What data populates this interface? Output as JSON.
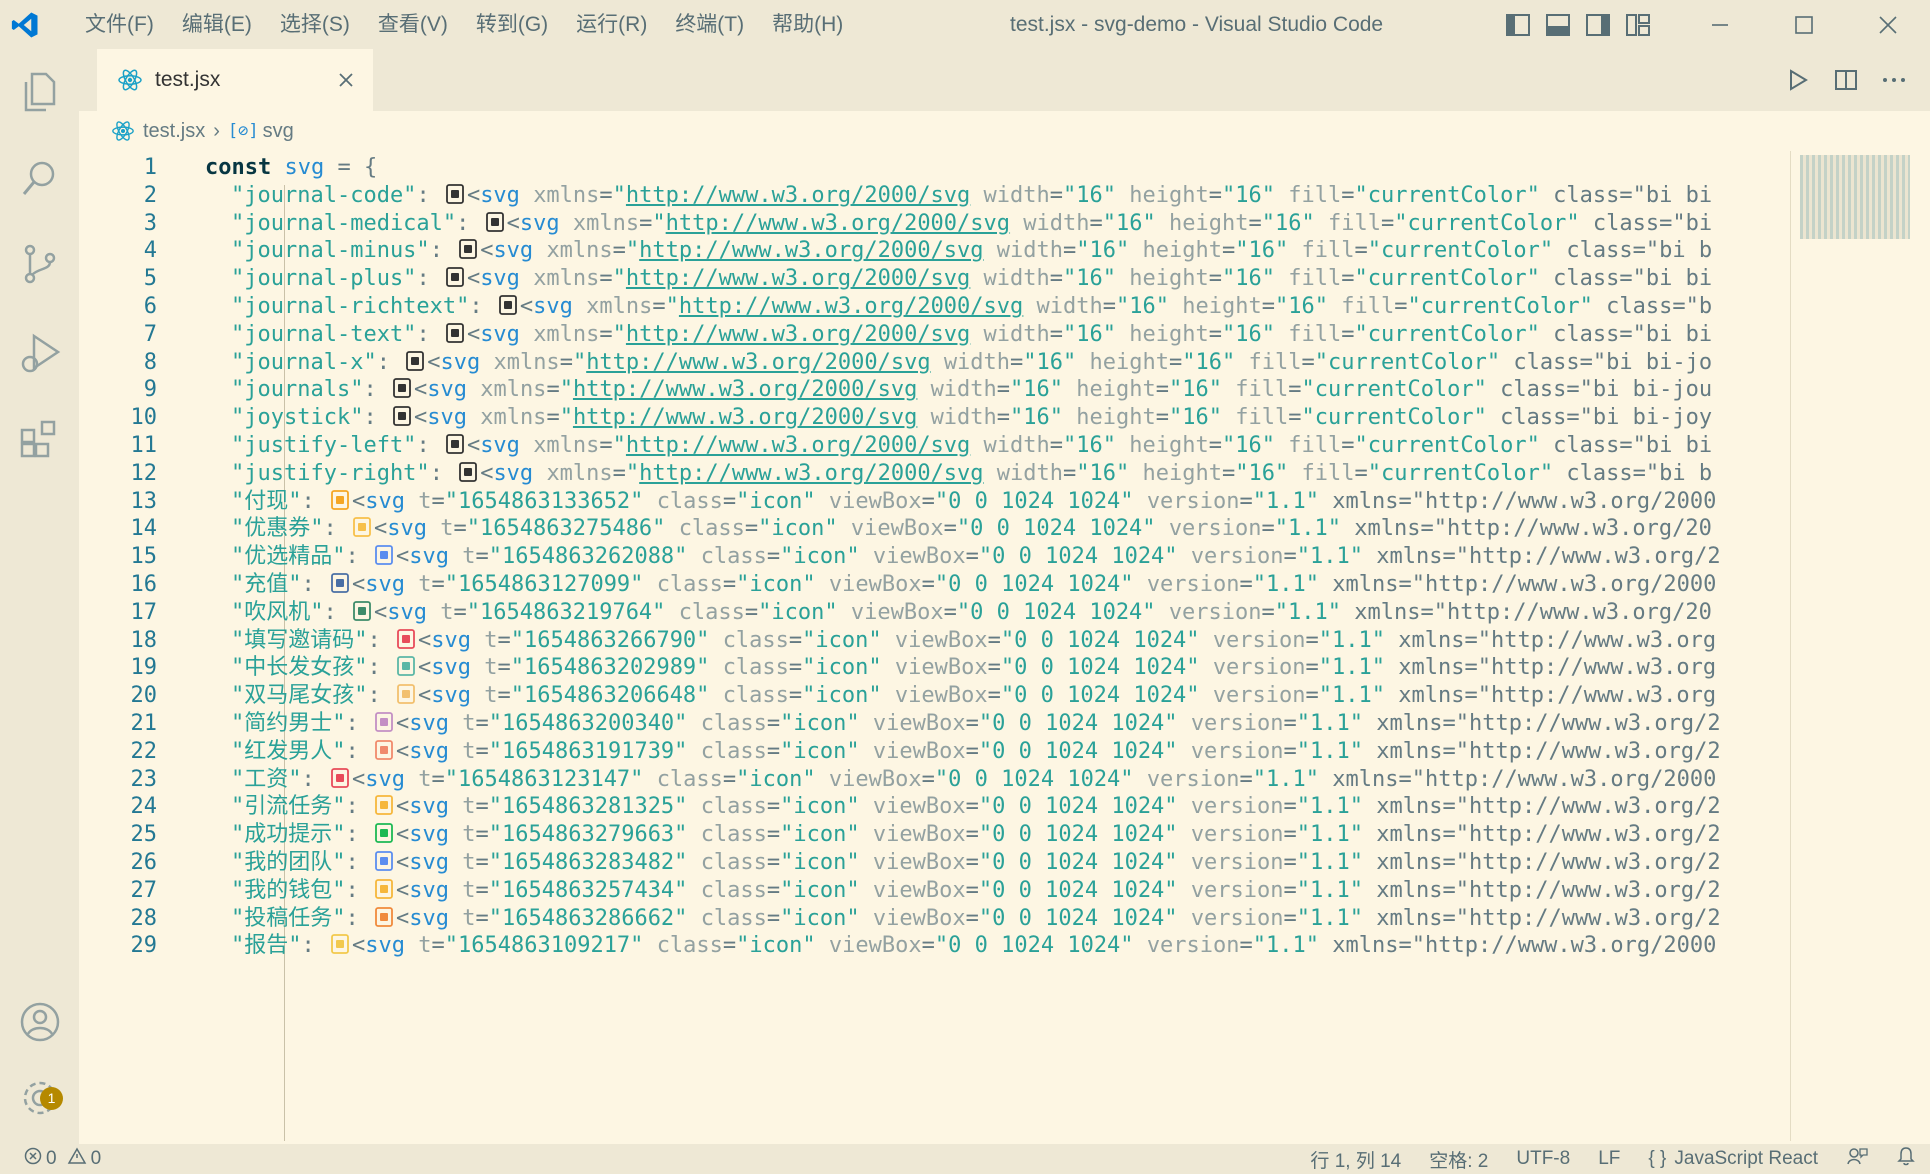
{
  "window": {
    "title": "test.jsx - svg-demo - Visual Studio Code",
    "menu": [
      "文件(F)",
      "编辑(E)",
      "选择(S)",
      "查看(V)",
      "转到(G)",
      "运行(R)",
      "终端(T)",
      "帮助(H)"
    ]
  },
  "tab": {
    "label": "test.jsx"
  },
  "breadcrumb": {
    "file": "test.jsx",
    "symbol": "svg"
  },
  "status": {
    "errors": "0",
    "warnings": "0",
    "position": "行 1, 列 14",
    "indent": "空格: 2",
    "encoding": "UTF-8",
    "eol": "LF",
    "language": "JavaScript React"
  },
  "badge": {
    "count": "1"
  },
  "colors": {
    "accent": "#b58900",
    "bg": "#fdf6e3",
    "chrome": "#eee8d5"
  },
  "code_lines": [
    {
      "n": "1",
      "key": "",
      "text": "const svg = {",
      "kind": "head"
    },
    {
      "n": "2",
      "key": "\"journal-code\"",
      "rest": "<svg xmlns=\"http://www.w3.org/2000/svg\" width=\"16\" height=\"16\" fill=\"currentColor\" class=\"bi bi"
    },
    {
      "n": "3",
      "key": "\"journal-medical\"",
      "rest": "<svg xmlns=\"http://www.w3.org/2000/svg\" width=\"16\" height=\"16\" fill=\"currentColor\" class=\"bi"
    },
    {
      "n": "4",
      "key": "\"journal-minus\"",
      "rest": "<svg xmlns=\"http://www.w3.org/2000/svg\" width=\"16\" height=\"16\" fill=\"currentColor\" class=\"bi b"
    },
    {
      "n": "5",
      "key": "\"journal-plus\"",
      "rest": "<svg xmlns=\"http://www.w3.org/2000/svg\" width=\"16\" height=\"16\" fill=\"currentColor\" class=\"bi bi"
    },
    {
      "n": "6",
      "key": "\"journal-richtext\"",
      "rest": "<svg xmlns=\"http://www.w3.org/2000/svg\" width=\"16\" height=\"16\" fill=\"currentColor\" class=\"b"
    },
    {
      "n": "7",
      "key": "\"journal-text\"",
      "rest": "<svg xmlns=\"http://www.w3.org/2000/svg\" width=\"16\" height=\"16\" fill=\"currentColor\" class=\"bi bi"
    },
    {
      "n": "8",
      "key": "\"journal-x\"",
      "rest": "<svg xmlns=\"http://www.w3.org/2000/svg\" width=\"16\" height=\"16\" fill=\"currentColor\" class=\"bi bi-jo"
    },
    {
      "n": "9",
      "key": "\"journals\"",
      "rest": "<svg xmlns=\"http://www.w3.org/2000/svg\" width=\"16\" height=\"16\" fill=\"currentColor\" class=\"bi bi-jou"
    },
    {
      "n": "10",
      "key": "\"joystick\"",
      "rest": "<svg xmlns=\"http://www.w3.org/2000/svg\" width=\"16\" height=\"16\" fill=\"currentColor\" class=\"bi bi-joy"
    },
    {
      "n": "11",
      "key": "\"justify-left\"",
      "rest": "<svg xmlns=\"http://www.w3.org/2000/svg\" width=\"16\" height=\"16\" fill=\"currentColor\" class=\"bi bi"
    },
    {
      "n": "12",
      "key": "\"justify-right\"",
      "rest": "<svg xmlns=\"http://www.w3.org/2000/svg\" width=\"16\" height=\"16\" fill=\"currentColor\" class=\"bi b"
    },
    {
      "n": "13",
      "key": "\"付现\"",
      "rest": "<svg t=\"1654863133652\" class=\"icon\" viewBox=\"0 0 1024 1024\" version=\"1.1\" xmlns=\"http://www.w3.org/2000"
    },
    {
      "n": "14",
      "key": "\"优惠券\"",
      "rest": "<svg t=\"1654863275486\" class=\"icon\" viewBox=\"0 0 1024 1024\" version=\"1.1\" xmlns=\"http://www.w3.org/20"
    },
    {
      "n": "15",
      "key": "\"优选精品\"",
      "rest": "<svg t=\"1654863262088\" class=\"icon\" viewBox=\"0 0 1024 1024\" version=\"1.1\" xmlns=\"http://www.w3.org/2"
    },
    {
      "n": "16",
      "key": "\"充值\"",
      "rest": "<svg t=\"1654863127099\" class=\"icon\" viewBox=\"0 0 1024 1024\" version=\"1.1\" xmlns=\"http://www.w3.org/2000"
    },
    {
      "n": "17",
      "key": "\"吹风机\"",
      "rest": "<svg t=\"1654863219764\" class=\"icon\" viewBox=\"0 0 1024 1024\" version=\"1.1\" xmlns=\"http://www.w3.org/20"
    },
    {
      "n": "18",
      "key": "\"填写邀请码\"",
      "rest": "<svg t=\"1654863266790\" class=\"icon\" viewBox=\"0 0 1024 1024\" version=\"1.1\" xmlns=\"http://www.w3.org"
    },
    {
      "n": "19",
      "key": "\"中长发女孩\"",
      "rest": "<svg t=\"1654863202989\" class=\"icon\" viewBox=\"0 0 1024 1024\" version=\"1.1\" xmlns=\"http://www.w3.org"
    },
    {
      "n": "20",
      "key": "\"双马尾女孩\"",
      "rest": "<svg t=\"1654863206648\" class=\"icon\" viewBox=\"0 0 1024 1024\" version=\"1.1\" xmlns=\"http://www.w3.org"
    },
    {
      "n": "21",
      "key": "\"简约男士\"",
      "rest": "<svg t=\"1654863200340\" class=\"icon\" viewBox=\"0 0 1024 1024\" version=\"1.1\" xmlns=\"http://www.w3.org/2"
    },
    {
      "n": "22",
      "key": "\"红发男人\"",
      "rest": "<svg t=\"1654863191739\" class=\"icon\" viewBox=\"0 0 1024 1024\" version=\"1.1\" xmlns=\"http://www.w3.org/2"
    },
    {
      "n": "23",
      "key": "\"工资\"",
      "rest": "<svg t=\"1654863123147\" class=\"icon\" viewBox=\"0 0 1024 1024\" version=\"1.1\" xmlns=\"http://www.w3.org/2000"
    },
    {
      "n": "24",
      "key": "\"引流任务\"",
      "rest": "<svg t=\"1654863281325\" class=\"icon\" viewBox=\"0 0 1024 1024\" version=\"1.1\" xmlns=\"http://www.w3.org/2"
    },
    {
      "n": "25",
      "key": "\"成功提示\"",
      "rest": "<svg t=\"1654863279663\" class=\"icon\" viewBox=\"0 0 1024 1024\" version=\"1.1\" xmlns=\"http://www.w3.org/2"
    },
    {
      "n": "26",
      "key": "\"我的团队\"",
      "rest": "<svg t=\"1654863283482\" class=\"icon\" viewBox=\"0 0 1024 1024\" version=\"1.1\" xmlns=\"http://www.w3.org/2"
    },
    {
      "n": "27",
      "key": "\"我的钱包\"",
      "rest": "<svg t=\"1654863257434\" class=\"icon\" viewBox=\"0 0 1024 1024\" version=\"1.1\" xmlns=\"http://www.w3.org/2"
    },
    {
      "n": "28",
      "key": "\"投稿任务\"",
      "rest": "<svg t=\"1654863286662\" class=\"icon\" viewBox=\"0 0 1024 1024\" version=\"1.1\" xmlns=\"http://www.w3.org/2"
    },
    {
      "n": "29",
      "key": "\"报告\"",
      "rest": "<svg t=\"1654863109217\" class=\"icon\" viewBox=\"0 0 1024 1024\" version=\"1.1\" xmlns=\"http://www.w3.org/2000"
    }
  ],
  "line_icons": [
    "journal-code-icon",
    "journal-medical-icon",
    "journal-minus-icon",
    "journal-plus-icon",
    "journal-richtext-icon",
    "journal-text-icon",
    "journal-x-icon",
    "journals-icon",
    "joystick-icon",
    "justify-left-icon",
    "justify-right-icon",
    "cash-icon",
    "coupon-icon",
    "premium-icon",
    "recharge-icon",
    "hair-dryer-icon",
    "invite-code-icon",
    "girl-long-hair-icon",
    "girl-twin-tails-icon",
    "man-simple-icon",
    "man-red-hair-icon",
    "salary-icon",
    "traffic-task-icon",
    "success-icon",
    "team-icon",
    "wallet-icon",
    "submit-task-icon",
    "report-icon"
  ],
  "line_icon_colors": [
    "#333",
    "#333",
    "#333",
    "#333",
    "#333",
    "#333",
    "#333",
    "#333",
    "#333",
    "#333",
    "#333",
    "#f5a623",
    "#f7c04a",
    "#5b8def",
    "#4a6fa5",
    "#3d8b6a",
    "#e84b5a",
    "#5bb7a6",
    "#f2c06e",
    "#c38fc4",
    "#f08a6c",
    "#e84b5a",
    "#f6b73c",
    "#1db954",
    "#5b8def",
    "#f6b73c",
    "#f08a3c",
    "#f2c94c"
  ]
}
